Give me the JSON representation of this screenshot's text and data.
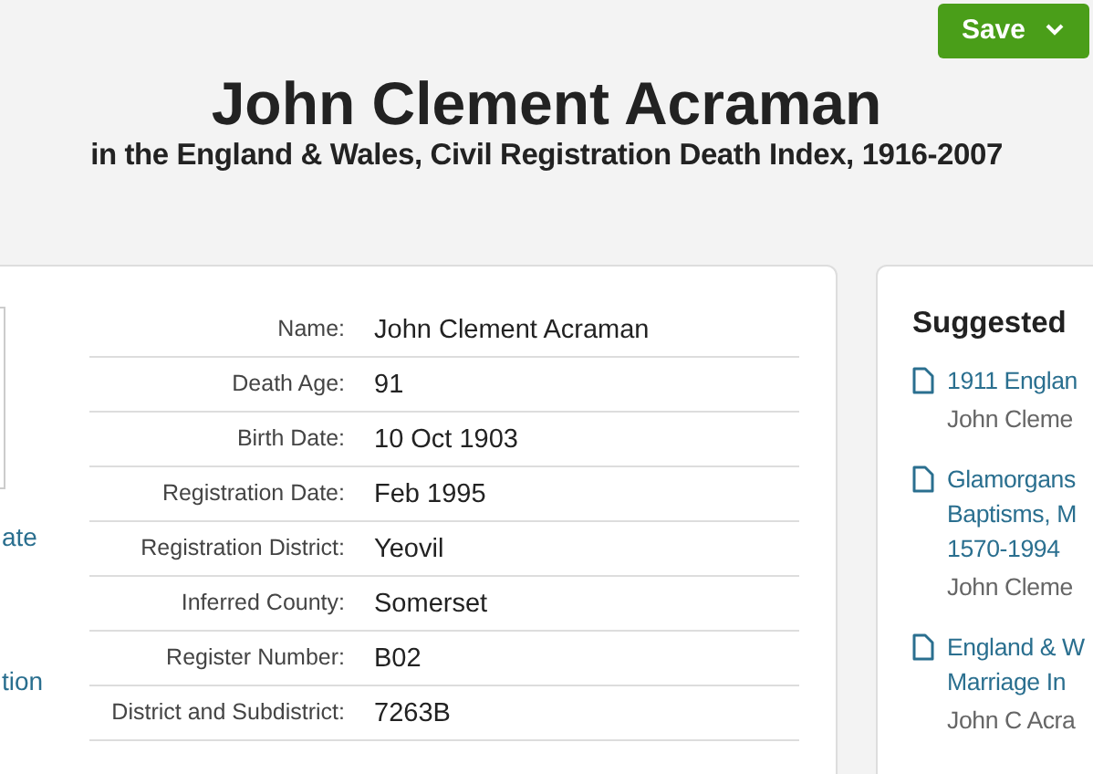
{
  "save_button": {
    "label": "Save"
  },
  "title": "John Clement Acraman",
  "subtitle": "in the England & Wales, Civil Registration Death Index, 1916-2007",
  "left_links": [
    "ate",
    "tion"
  ],
  "fields": [
    {
      "label": "Name:",
      "value": "John Clement Acraman"
    },
    {
      "label": "Death Age:",
      "value": "91"
    },
    {
      "label": "Birth Date:",
      "value": "10 Oct 1903"
    },
    {
      "label": "Registration Date:",
      "value": "Feb 1995"
    },
    {
      "label": "Registration District:",
      "value": "Yeovil"
    },
    {
      "label": "Inferred County:",
      "value": "Somerset"
    },
    {
      "label": "Register Number:",
      "value": "B02"
    },
    {
      "label": "District and Subdistrict:",
      "value": "7263B"
    }
  ],
  "suggested": {
    "title": "Suggested",
    "items": [
      {
        "title_lines": [
          "1911 Englan"
        ],
        "name": "John Cleme"
      },
      {
        "title_lines": [
          "Glamorgans",
          "Baptisms, M",
          "1570-1994"
        ],
        "name": "John Cleme"
      },
      {
        "title_lines": [
          "England & W",
          "Marriage In"
        ],
        "name": "John C Acra"
      }
    ]
  }
}
